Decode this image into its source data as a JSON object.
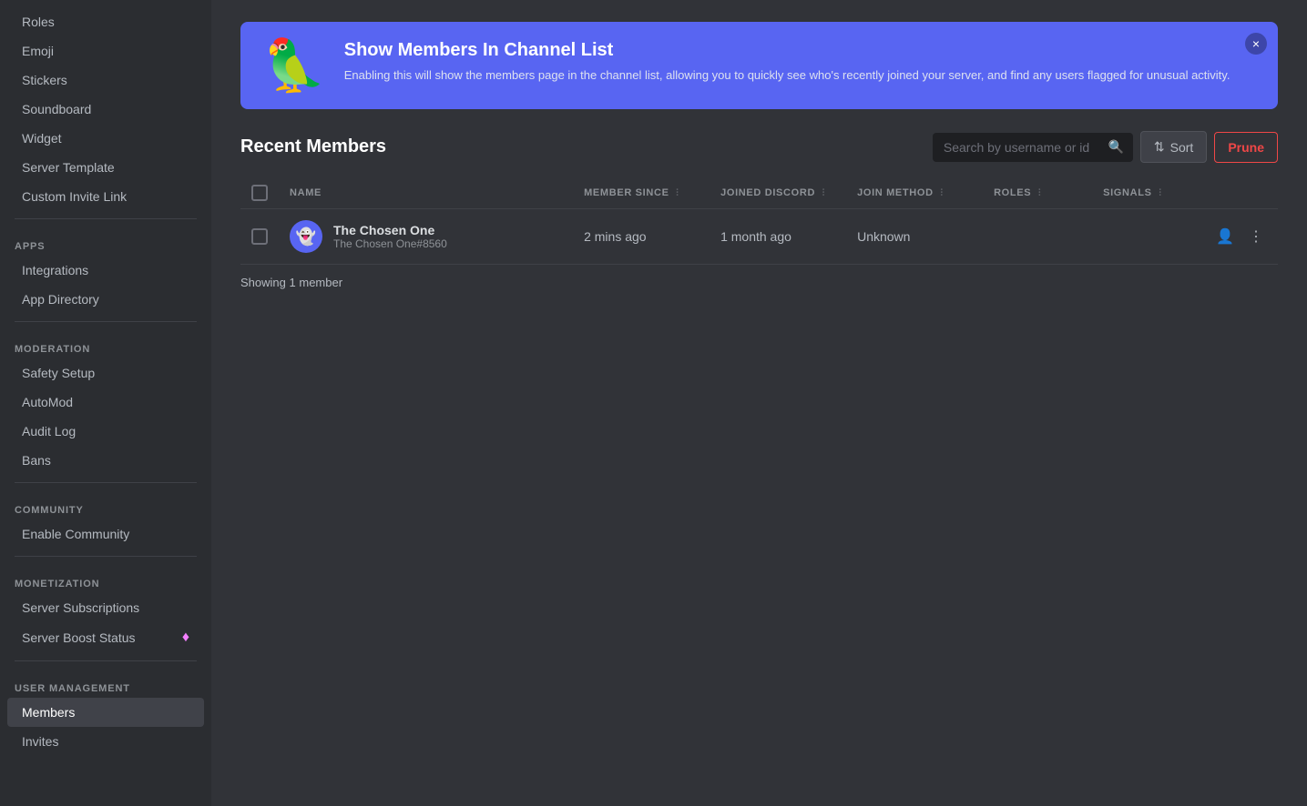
{
  "sidebar": {
    "items": [
      {
        "id": "roles",
        "label": "Roles",
        "active": false
      },
      {
        "id": "emoji",
        "label": "Emoji",
        "active": false
      },
      {
        "id": "stickers",
        "label": "Stickers",
        "active": false
      },
      {
        "id": "soundboard",
        "label": "Soundboard",
        "active": false
      },
      {
        "id": "widget",
        "label": "Widget",
        "active": false
      },
      {
        "id": "server-template",
        "label": "Server Template",
        "active": false
      },
      {
        "id": "custom-invite-link",
        "label": "Custom Invite Link",
        "active": false
      }
    ],
    "sections": {
      "apps": {
        "label": "APPS",
        "items": [
          {
            "id": "integrations",
            "label": "Integrations",
            "active": false
          },
          {
            "id": "app-directory",
            "label": "App Directory",
            "active": false
          }
        ]
      },
      "moderation": {
        "label": "MODERATION",
        "items": [
          {
            "id": "safety-setup",
            "label": "Safety Setup",
            "active": false
          },
          {
            "id": "automod",
            "label": "AutoMod",
            "active": false
          },
          {
            "id": "audit-log",
            "label": "Audit Log",
            "active": false
          },
          {
            "id": "bans",
            "label": "Bans",
            "active": false
          }
        ]
      },
      "community": {
        "label": "COMMUNITY",
        "items": [
          {
            "id": "enable-community",
            "label": "Enable Community",
            "active": false
          }
        ]
      },
      "monetization": {
        "label": "MONETIZATION",
        "items": [
          {
            "id": "server-subscriptions",
            "label": "Server Subscriptions",
            "active": false
          },
          {
            "id": "server-boost-status",
            "label": "Server Boost Status",
            "active": false,
            "badge": "♦"
          }
        ]
      },
      "user_management": {
        "label": "USER MANAGEMENT",
        "items": [
          {
            "id": "members",
            "label": "Members",
            "active": true
          },
          {
            "id": "invites",
            "label": "Invites",
            "active": false
          }
        ]
      }
    }
  },
  "banner": {
    "emoji": "🦜",
    "title": "Show Members In Channel List",
    "description": "Enabling this will show the members page in the channel list, allowing you to quickly see who's recently joined your server, and find any users flagged for unusual activity.",
    "close_label": "×"
  },
  "members": {
    "title": "Recent Members",
    "search_placeholder": "Search by username or id",
    "sort_label": "Sort",
    "prune_label": "Prune",
    "columns": {
      "name": "NAME",
      "member_since": "MEMBER SINCE",
      "joined_discord": "JOINED DISCORD",
      "join_method": "JOIN METHOD",
      "roles": "ROLES",
      "signals": "SIGNALS"
    },
    "rows": [
      {
        "id": "1",
        "name": "The Chosen One",
        "tag": "The Chosen One#8560",
        "avatar_emoji": "👻",
        "member_since": "2 mins ago",
        "joined_discord": "1 month ago",
        "join_method": "Unknown",
        "roles": "",
        "signals": ""
      }
    ],
    "showing_text": "Showing",
    "showing_count": "1",
    "showing_unit": "member"
  }
}
